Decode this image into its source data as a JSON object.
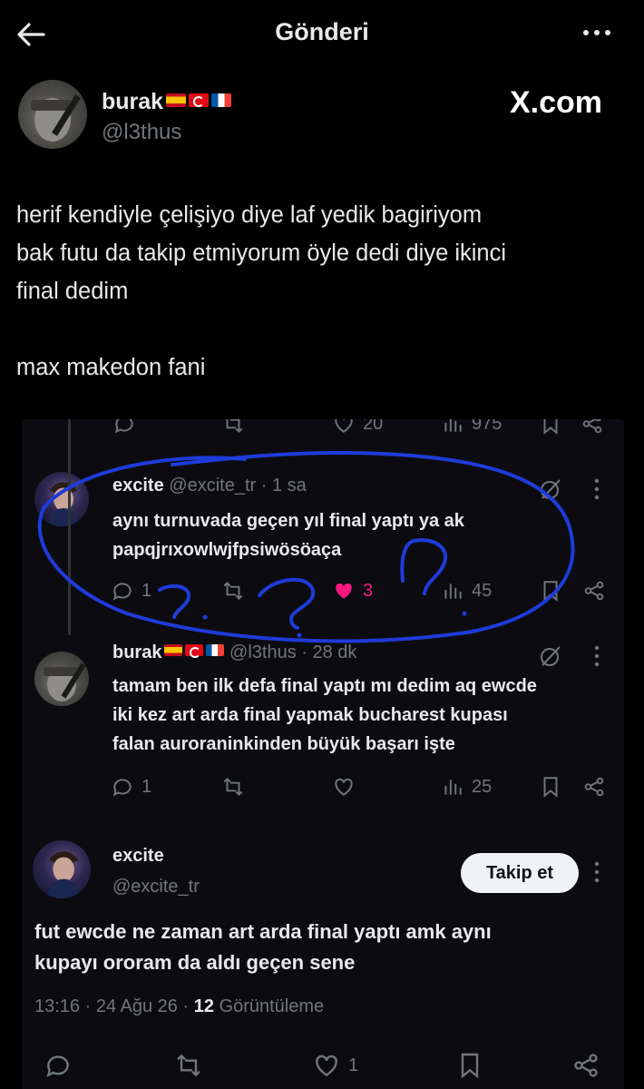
{
  "header": {
    "title": "Gönderi"
  },
  "author": {
    "name": "burak",
    "handle": "@l3thus",
    "flags": [
      "spain-flag",
      "turkey-flag",
      "france-flag"
    ]
  },
  "watermark": "X.com",
  "tweet": {
    "lines": [
      "herif kendiyle çelişiyo diye laf yedik bagiriyom",
      "bak futu da takip etmiyorum öyle dedi diye ikinci",
      "final dedim"
    ],
    "line2": "max makedon fani"
  },
  "embedded": {
    "top_actions": {
      "likes": "20",
      "views": "975"
    },
    "reply1": {
      "name": "excite",
      "handle": "@excite_tr",
      "time": "· 1 sa",
      "line1": "aynı turnuvada geçen yıl final yaptı ya ak",
      "line2": "papqjrıxowlwjfpsiwösöaça",
      "replies": "1",
      "likes": "3",
      "views": "45"
    },
    "reply2": {
      "name": "burak",
      "handle": "@l3thus",
      "time": "· 28 dk",
      "line1": "tamam ben ilk defa final yaptı mı dedim aq ewcde",
      "line2": "iki kez art arda final yapmak bucharest kupası",
      "line3": "falan auroraninkinden büyük başarı işte",
      "replies": "1",
      "views": "25"
    },
    "main2": {
      "name": "excite",
      "handle": "@excite_tr",
      "follow_label": "Takip et",
      "line1": "fut ewcde ne zaman art arda final yaptı amk aynı",
      "line2": "kupayı ororam da aldı geçen sene",
      "time": "13:16",
      "date": "· 24 Ağu 26 ·",
      "views": "12",
      "views_label": "Görüntüleme",
      "likes": "1"
    }
  },
  "colors": {
    "scribble": "#1f3bd9",
    "like_pink": "#f91880",
    "muted": "#71767b"
  }
}
